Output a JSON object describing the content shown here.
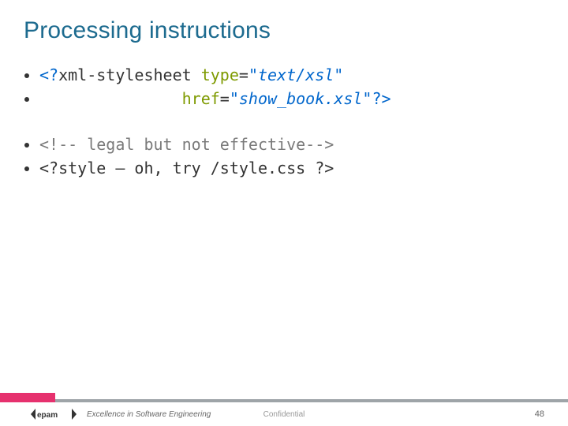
{
  "title": "Processing instructions",
  "code": {
    "line1": {
      "open": "<?",
      "tag": "xml-stylesheet ",
      "attr": "type",
      "eq": "=",
      "val": "\"text/xsl\""
    },
    "line2": {
      "pad": "               ",
      "attr": "href",
      "eq": "=",
      "val": "\"show_book.xsl\"",
      "close": "?>"
    },
    "line3": "<!-- legal but not effective-->",
    "line4": "<?style – oh, try /style.css ?>"
  },
  "footer": {
    "tagline": "Excellence in Software Engineering",
    "confidential": "Confidential",
    "page": "48",
    "logo_text": "epam"
  }
}
